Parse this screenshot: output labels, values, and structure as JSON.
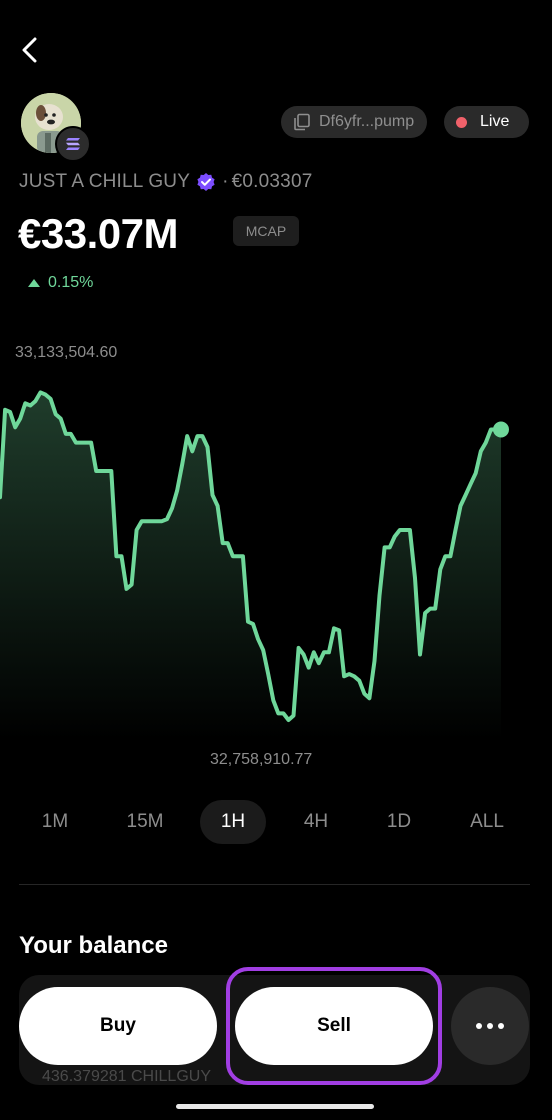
{
  "header": {
    "back_icon": "chevron-left-icon",
    "address": "Df6yfr...pump",
    "copy_icon": "copy-icon",
    "live_label": "Live"
  },
  "token": {
    "name": "JUST A CHILL GUY",
    "verified_icon": "verified-badge-icon",
    "separator": "·",
    "price": "€0.03307",
    "market_cap": "€33.07M",
    "market_cap_tag": "MCAP",
    "change": "0.15%",
    "change_direction": "up",
    "change_color": "#6fd79a"
  },
  "chart_data": {
    "type": "area",
    "high_label": "33,133,504.60",
    "low_label": "32,758,910.77",
    "line_color": "#6fd79a",
    "values": [
      0.05,
      0.45,
      0.44,
      0.37,
      0.41,
      0.48,
      0.47,
      0.49,
      0.53,
      0.52,
      0.5,
      0.43,
      0.41,
      0.34,
      0.34,
      0.3,
      0.3,
      0.3,
      0.3,
      0.17,
      0.17,
      0.17,
      0.17,
      -0.22,
      -0.22,
      -0.37,
      -0.35,
      -0.1,
      -0.06,
      -0.06,
      -0.06,
      -0.06,
      -0.06,
      -0.05,
      0.0,
      0.08,
      0.2,
      0.33,
      0.26,
      0.33,
      0.33,
      0.28,
      0.06,
      0.01,
      -0.16,
      -0.16,
      -0.22,
      -0.22,
      -0.22,
      -0.52,
      -0.53,
      -0.6,
      -0.65,
      -0.76,
      -0.88,
      -0.94,
      -0.94,
      -0.97,
      -0.95,
      -0.64,
      -0.67,
      -0.73,
      -0.66,
      -0.71,
      -0.66,
      -0.66,
      -0.55,
      -0.56,
      -0.77,
      -0.76,
      -0.77,
      -0.79,
      -0.85,
      -0.87,
      -0.7,
      -0.4,
      -0.18,
      -0.18,
      -0.13,
      -0.1,
      -0.1,
      -0.1,
      -0.32,
      -0.67,
      -0.48,
      -0.46,
      -0.46,
      -0.28,
      -0.22,
      -0.22,
      -0.1,
      0.01,
      0.06,
      0.11,
      0.16,
      0.26,
      0.3,
      0.36,
      0.36,
      0.36
    ]
  },
  "timeframes": [
    {
      "label": "1M",
      "active": false
    },
    {
      "label": "15M",
      "active": false
    },
    {
      "label": "1H",
      "active": true
    },
    {
      "label": "4H",
      "active": false
    },
    {
      "label": "1D",
      "active": false
    },
    {
      "label": "ALL",
      "active": false
    }
  ],
  "balance": {
    "title": "Your balance",
    "amount": "436.379281 CHILLGUY"
  },
  "actions": {
    "buy_label": "Buy",
    "sell_label": "Sell",
    "more_icon": "more-horizontal-icon"
  },
  "colors": {
    "accent_green": "#6fd79a",
    "highlight_purple": "#a13ee3",
    "live_dot": "#f0616a"
  }
}
